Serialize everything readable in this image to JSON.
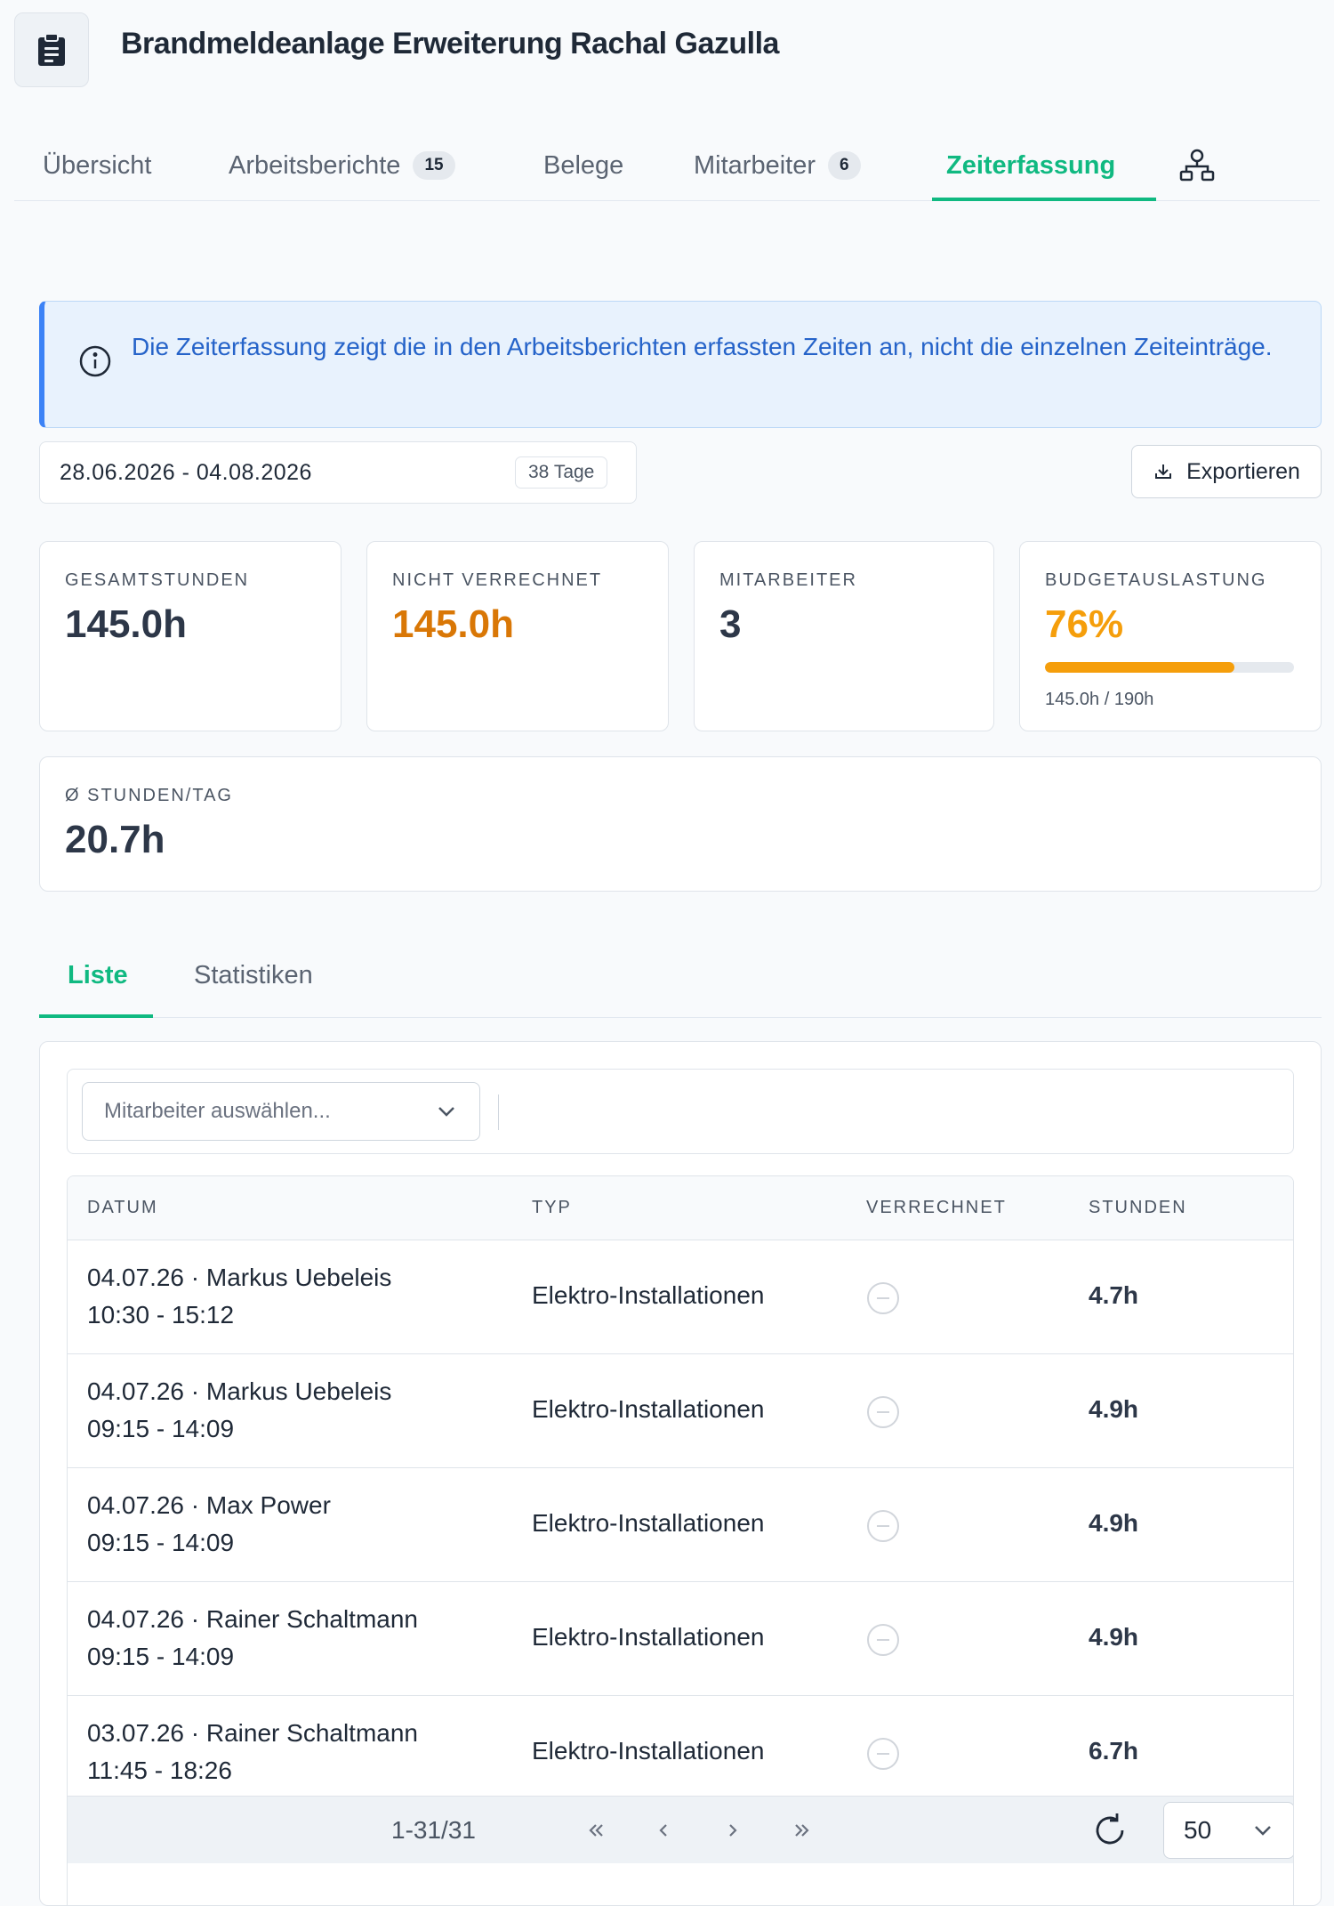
{
  "header": {
    "title": "Brandmeldeanlage Erweiterung Rachal Gazulla",
    "icon": "clipboard-icon"
  },
  "tabs": [
    {
      "label": "Übersicht",
      "count": null,
      "active": false
    },
    {
      "label": "Arbeitsberichte",
      "count": "15",
      "active": false
    },
    {
      "label": "Belege",
      "count": null,
      "active": false
    },
    {
      "label": "Mitarbeiter",
      "count": "6",
      "active": false
    },
    {
      "label": "Zeiterfassung",
      "count": null,
      "active": true
    }
  ],
  "tab_extra_icon": "org-chart-icon",
  "info": {
    "text": "Die Zeiterfassung zeigt die in den Arbeitsberichten erfassten Zeiten an, nicht die einzelnen Zeiteinträge."
  },
  "date_range": {
    "value": "28.06.2026 - 04.08.2026",
    "days": "38 Tage"
  },
  "export": {
    "label": "Exportieren"
  },
  "stats": {
    "total": {
      "label": "GESAMTSTUNDEN",
      "value": "145.0h"
    },
    "unbilled": {
      "label": "NICHT VERRECHNET",
      "value": "145.0h"
    },
    "employees": {
      "label": "MITARBEITER",
      "value": "3"
    },
    "budget": {
      "label": "BUDGETAUSLASTUNG",
      "value": "76%",
      "fraction": 0.76,
      "sub": "145.0h / 190h"
    },
    "per_day": {
      "label": "Ø STUNDEN/TAG",
      "value": "20.7h"
    }
  },
  "subtabs": [
    {
      "label": "Liste",
      "active": true
    },
    {
      "label": "Statistiken",
      "active": false
    }
  ],
  "filter": {
    "placeholder": "Mitarbeiter auswählen..."
  },
  "table": {
    "headers": {
      "date": "DATUM",
      "type": "TYP",
      "billed": "VERRECHNET",
      "hours": "STUNDEN"
    },
    "rows": [
      {
        "line1": "04.07.26 · Markus Uebeleis",
        "line2": "10:30 - 15:12",
        "type": "Elektro-Installationen",
        "billed": false,
        "hours": "4.7h"
      },
      {
        "line1": "04.07.26 · Markus Uebeleis",
        "line2": "09:15 - 14:09",
        "type": "Elektro-Installationen",
        "billed": false,
        "hours": "4.9h"
      },
      {
        "line1": "04.07.26 · Max Power",
        "line2": "09:15 - 14:09",
        "type": "Elektro-Installationen",
        "billed": false,
        "hours": "4.9h"
      },
      {
        "line1": "04.07.26 · Rainer Schaltmann",
        "line2": "09:15 - 14:09",
        "type": "Elektro-Installationen",
        "billed": false,
        "hours": "4.9h"
      },
      {
        "line1": "03.07.26 · Rainer Schaltmann",
        "line2": "11:45 - 18:26",
        "type": "Elektro-Installationen",
        "billed": false,
        "hours": "6.7h"
      }
    ]
  },
  "pager": {
    "range": "1-31/31",
    "per_page": "50"
  },
  "colors": {
    "accent": "#10b981",
    "info": "#2563c9",
    "orange": "#d97706",
    "amber": "#f59e0b"
  }
}
